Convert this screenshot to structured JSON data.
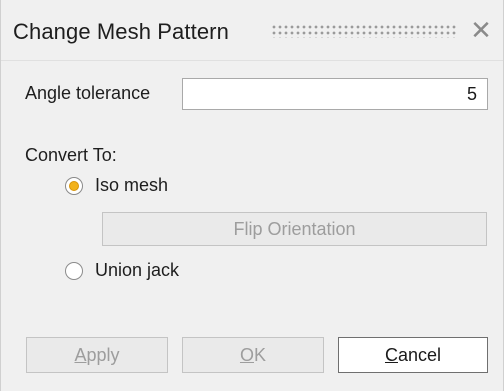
{
  "dialog": {
    "title": "Change Mesh Pattern",
    "close_symbol": "✕"
  },
  "angle": {
    "label": "Angle tolerance",
    "value": "5"
  },
  "convert": {
    "label": "Convert To:",
    "options": [
      {
        "label": "Iso mesh",
        "checked": true
      },
      {
        "label": "Union jack",
        "checked": false
      }
    ],
    "flip_label": "Flip Orientation"
  },
  "buttons": {
    "apply": {
      "mnemonic": "A",
      "rest": "pply"
    },
    "ok": {
      "mnemonic": "O",
      "rest": "K"
    },
    "cancel": {
      "mnemonic": "C",
      "rest": "ancel"
    }
  },
  "colors": {
    "radio_selected": "#f2b21b",
    "background": "#f0f0f0"
  }
}
